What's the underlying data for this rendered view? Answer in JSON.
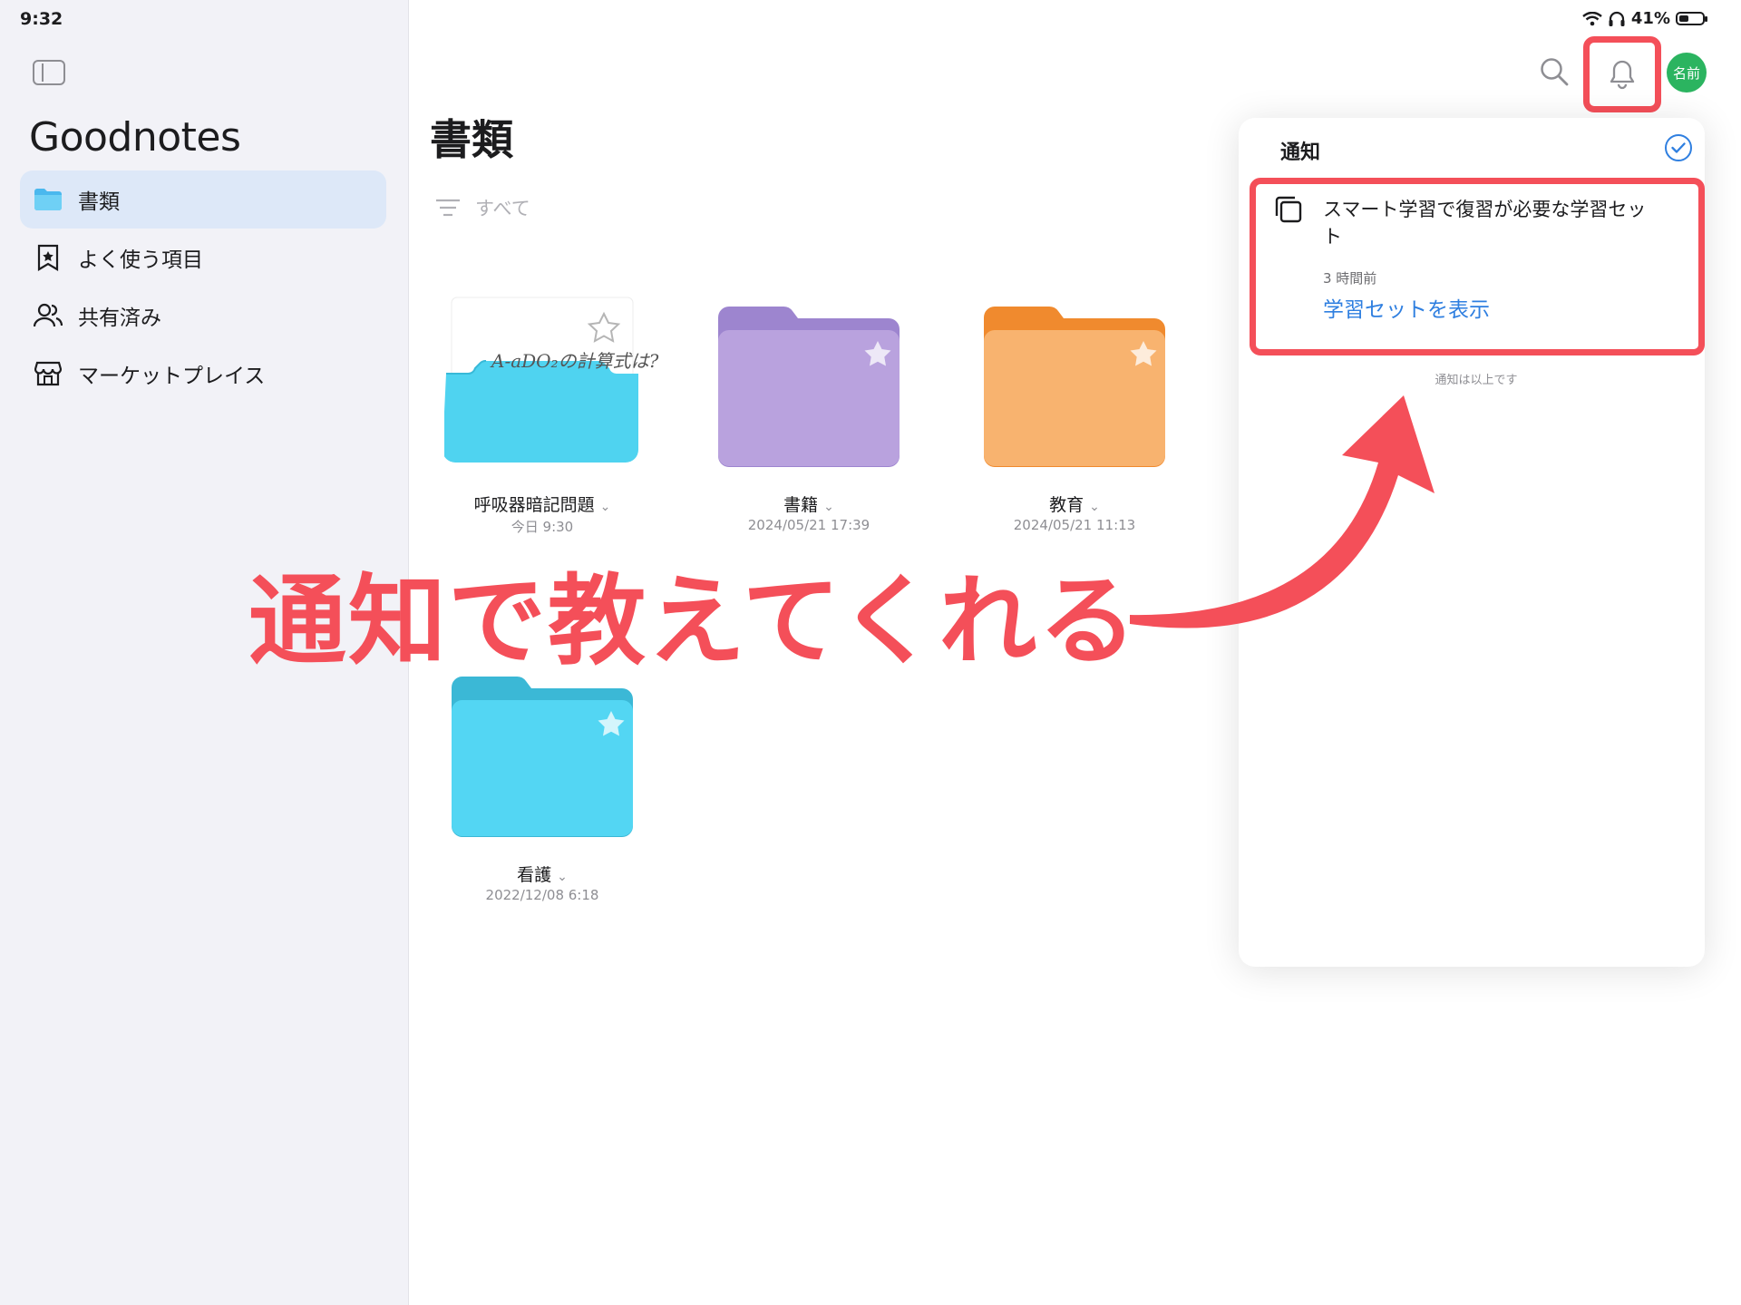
{
  "status_bar": {
    "time": "9:32",
    "battery": "41%",
    "battery_level": 0.41
  },
  "sidebar": {
    "app_title": "Goodnotes",
    "items": [
      {
        "label": "書類",
        "icon": "folder-icon",
        "active": true
      },
      {
        "label": "よく使う項目",
        "icon": "bookmark-star-icon",
        "active": false
      },
      {
        "label": "共有済み",
        "icon": "people-icon",
        "active": false
      },
      {
        "label": "マーケットプレイス",
        "icon": "store-icon",
        "active": false
      }
    ]
  },
  "main": {
    "title": "書類",
    "filter_label": "すべて",
    "items": [
      {
        "name": "呼吸器暗記問題",
        "date": "今日 9:30",
        "type": "notebook",
        "color": "#4fd3f0",
        "handwriting": "A-aDO₂の計算式は?"
      },
      {
        "name": "書籍",
        "date": "2024/05/21 17:39",
        "type": "folder",
        "color": "#b89fdd"
      },
      {
        "name": "教育",
        "date": "2024/05/21 11:13",
        "type": "folder",
        "color": "#f8ad6a"
      },
      {
        "name": "看護",
        "date": "2022/12/08 6:18",
        "type": "folder",
        "color": "#4fd3f0"
      }
    ]
  },
  "header": {
    "avatar_text": "名前"
  },
  "notifications": {
    "title": "通知",
    "items": [
      {
        "text": "スマート学習で復習が必要な学習セット",
        "time": "3 時間前",
        "action": "学習セットを表示"
      }
    ],
    "end_text": "通知は以上です"
  },
  "annotation": {
    "text": "通知で教えてくれる",
    "color": "#f44f59"
  }
}
